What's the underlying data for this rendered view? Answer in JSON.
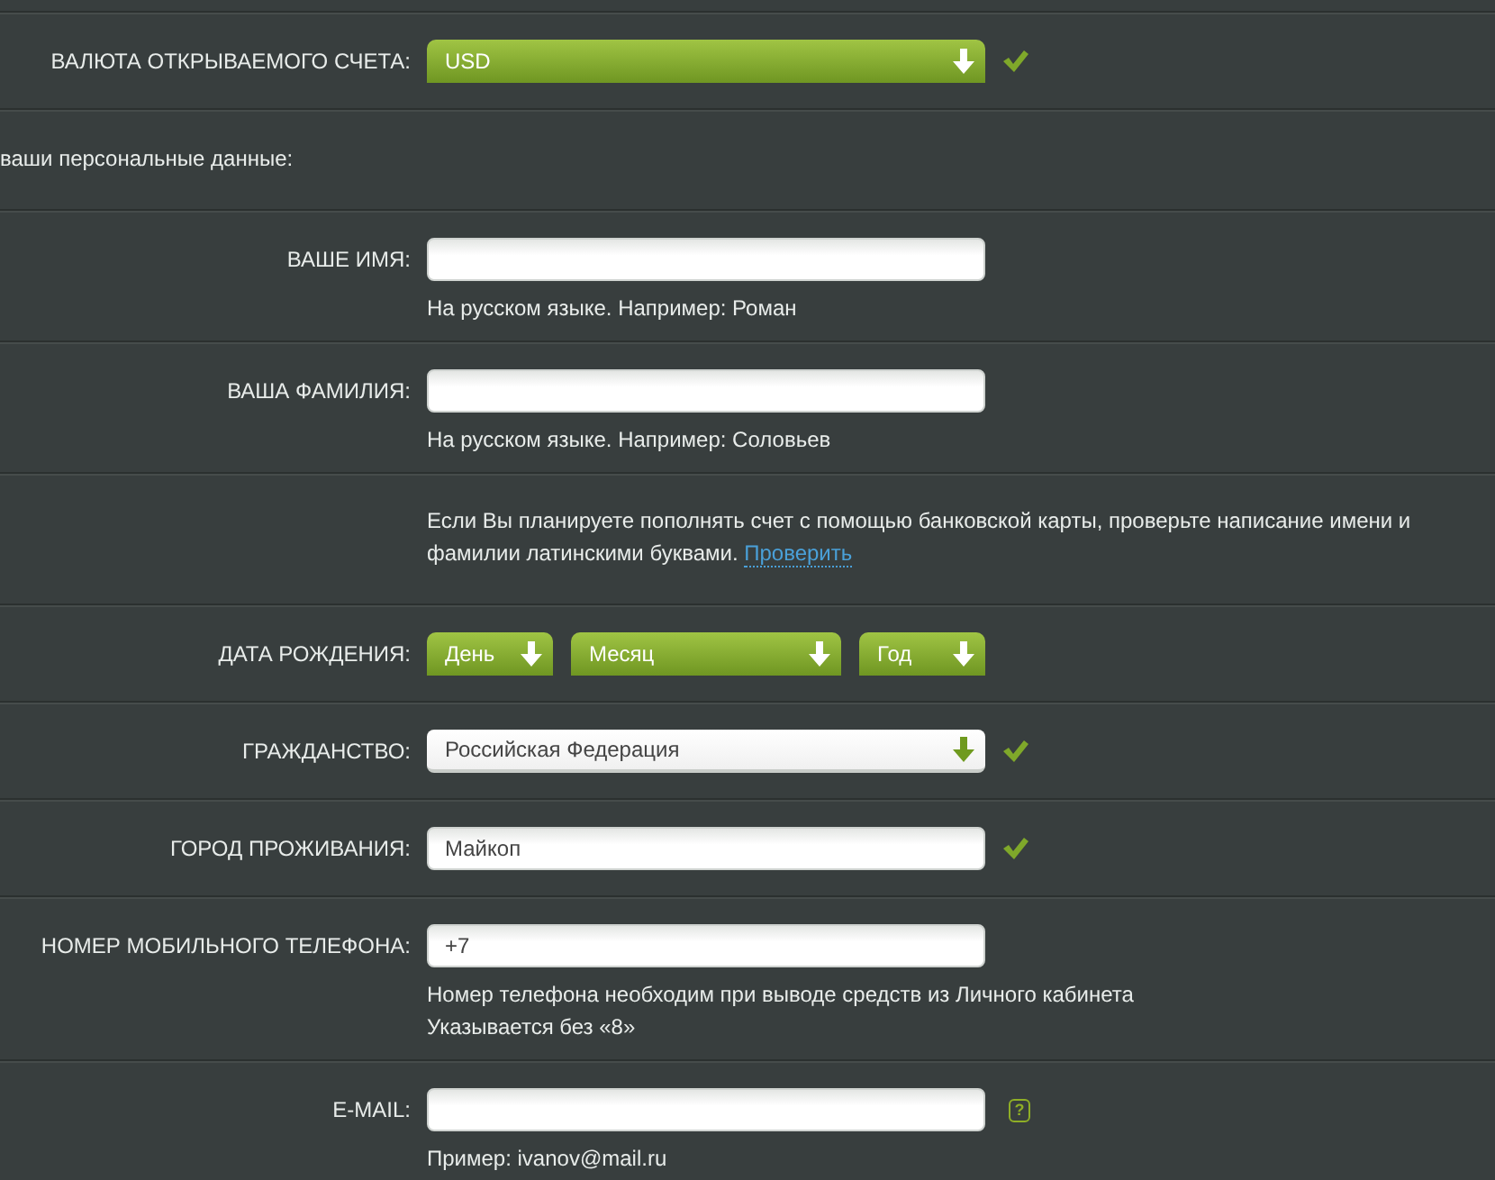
{
  "rows": [
    {
      "kind": "green-select",
      "label": "ВАЛЮТА ОТКРЫВАЕМОГО СЧЕТА:",
      "value": "USD",
      "valid": true
    },
    {
      "kind": "heading",
      "text": "ваши персональные данные:"
    },
    {
      "kind": "input",
      "label": "ВАШЕ ИМЯ:",
      "valid": false,
      "hints": [
        "На русском языке. Например: Роман"
      ]
    },
    {
      "kind": "input",
      "label": "ВАША ФАМИЛИЯ:",
      "valid": false,
      "hints": [
        "На русском языке. Например: Соловьев"
      ]
    },
    {
      "kind": "note",
      "text": "Если Вы планируете пополнять счет с помощью банковской карты, проверьте написание имени и фамилии латинскими буквами.",
      "link": "Проверить"
    },
    {
      "kind": "date",
      "label": "ДАТА РОЖДЕНИЯ:",
      "selects": [
        "День",
        "Месяц",
        "Год"
      ]
    },
    {
      "kind": "select",
      "label": "ГРАЖДАНСТВО:",
      "value": "Российская Федерация",
      "valid": true
    },
    {
      "kind": "input",
      "label": "ГОРОД ПРОЖИВАНИЯ:",
      "value": "Майкоп",
      "valid": true
    },
    {
      "kind": "input",
      "label": "НОМЕР МОБИЛЬНОГО ТЕЛЕФОНА:",
      "value": "+7",
      "valid": false,
      "hints": [
        "Номер телефона необходим при выводе средств из Личного кабинета",
        "Указывается без «8»"
      ]
    },
    {
      "kind": "input",
      "label": "E-MAIL:",
      "valid": false,
      "help": "?",
      "hints": [
        "Пример: ivanov@mail.ru"
      ]
    }
  ]
}
